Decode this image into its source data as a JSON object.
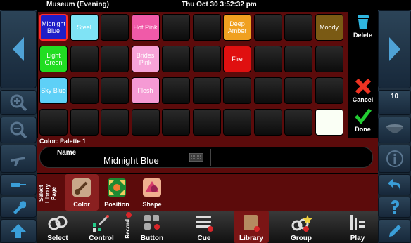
{
  "status": {
    "venue": "Museum (Evening)",
    "clock": "Thu Oct 30 3:52:32 pm"
  },
  "colors": {
    "accent_red": "#5c0b0b",
    "selection": "#ff2a2a"
  },
  "grid_rows": [
    [
      {
        "label": "Midnight Blue",
        "color": "#1e1ec8",
        "selected": true
      },
      {
        "label": "Steel",
        "color": "#7fe3f5"
      },
      {
        "label": "",
        "color": ""
      },
      {
        "label": "Hot Pink",
        "color": "#f05aa8"
      },
      {
        "label": "",
        "color": ""
      },
      {
        "label": "",
        "color": ""
      },
      {
        "label": "Deep Amber",
        "color": "#f0a020"
      },
      {
        "label": "",
        "color": ""
      },
      {
        "label": "",
        "color": ""
      },
      {
        "label": "Moody",
        "color": "#7a5a14"
      }
    ],
    [
      {
        "label": "Light Green",
        "color": "#22dd22"
      },
      {
        "label": "",
        "color": ""
      },
      {
        "label": "",
        "color": ""
      },
      {
        "label": "Brides Pink",
        "color": "#f7a3d8"
      },
      {
        "label": "",
        "color": ""
      },
      {
        "label": "",
        "color": ""
      },
      {
        "label": "Fire",
        "color": "#e01010"
      },
      {
        "label": "",
        "color": ""
      },
      {
        "label": "",
        "color": ""
      },
      {
        "label": "",
        "color": ""
      }
    ],
    [
      {
        "label": "Sky Blue",
        "color": "#5ed0f7"
      },
      {
        "label": "",
        "color": ""
      },
      {
        "label": "",
        "color": ""
      },
      {
        "label": "Flesh",
        "color": "#f59ad4"
      },
      {
        "label": "",
        "color": ""
      },
      {
        "label": "",
        "color": ""
      },
      {
        "label": "",
        "color": ""
      },
      {
        "label": "",
        "color": ""
      },
      {
        "label": "",
        "color": ""
      },
      {
        "label": "",
        "color": ""
      }
    ],
    [
      {
        "label": "",
        "color": ""
      },
      {
        "label": "",
        "color": ""
      },
      {
        "label": "",
        "color": ""
      },
      {
        "label": "",
        "color": ""
      },
      {
        "label": "",
        "color": ""
      },
      {
        "label": "",
        "color": ""
      },
      {
        "label": "",
        "color": ""
      },
      {
        "label": "",
        "color": ""
      },
      {
        "label": "",
        "color": ""
      },
      {
        "label": "",
        "color": "#fafff5"
      }
    ]
  ],
  "actions": {
    "delete": "Delete",
    "cancel": "Cancel",
    "done": "Done",
    "count": "10"
  },
  "palette": {
    "label": "Color: Palette 1",
    "name_label": "Name",
    "name_value": "Midnight Blue"
  },
  "library": {
    "row_label": "Select Library Page",
    "buttons": [
      {
        "label": "Color",
        "icon": "brush-icon"
      },
      {
        "label": "Position",
        "icon": "position-icon"
      },
      {
        "label": "Shape",
        "icon": "shape-icon"
      }
    ]
  },
  "bottom": [
    {
      "label": "Select",
      "icon": "select-icon"
    },
    {
      "label": "Control",
      "icon": "control-icon"
    },
    {
      "label": "Record",
      "icon": "record-icon"
    },
    {
      "label": "Button",
      "icon": "button-icon"
    },
    {
      "label": "Cue",
      "icon": "cue-icon"
    },
    {
      "label": "Library",
      "icon": "library-icon",
      "active": true
    },
    {
      "label": "Group",
      "icon": "group-icon"
    },
    {
      "label": "Play",
      "icon": "play-icon"
    }
  ]
}
